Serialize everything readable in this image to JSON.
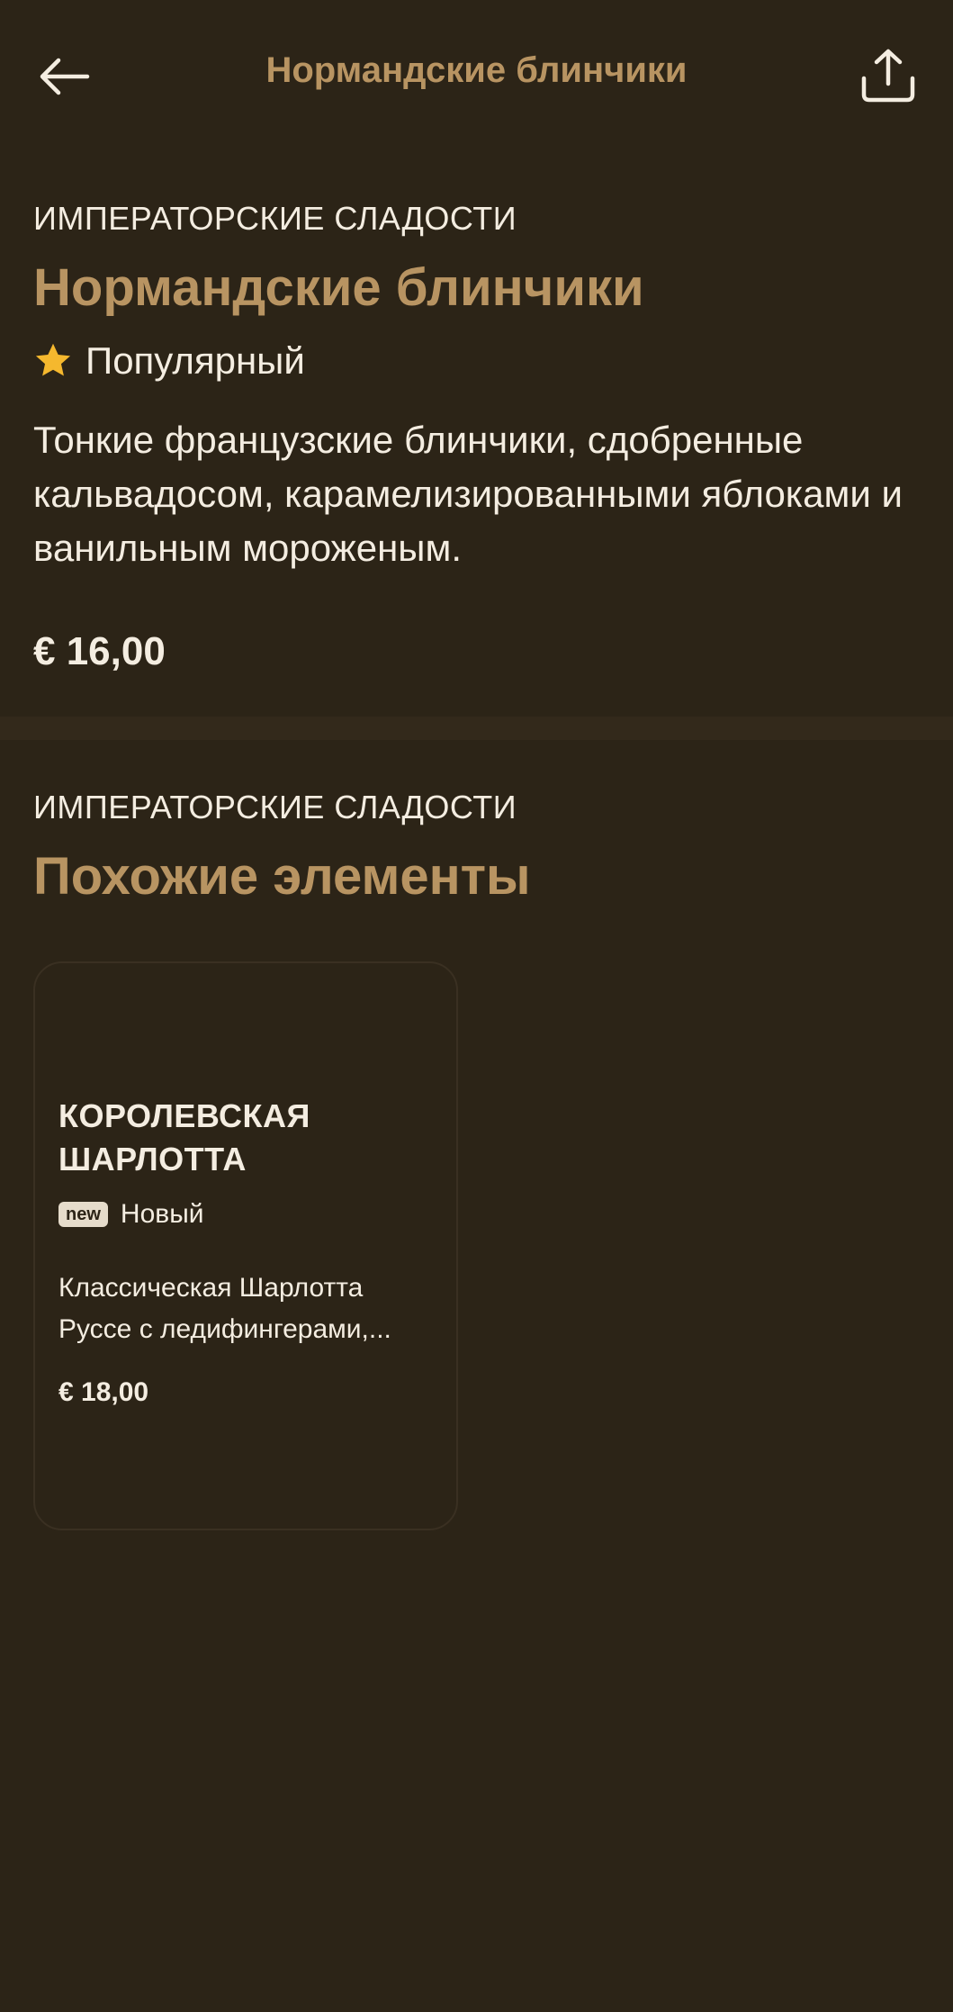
{
  "header": {
    "title": "Нормандские блинчики",
    "back_icon": "arrow-left-icon",
    "share_icon": "share-icon"
  },
  "dish": {
    "category": "ИМПЕРАТОРСКИЕ СЛАДОСТИ",
    "title": "Нормандские блинчики",
    "badge_icon": "star-icon",
    "badge_label": "Популярный",
    "description": "Тонкие французские блинчики, сдобренные кальвадосом, карамелизированными яблоками и ванильным мороженым.",
    "price": "€ 16,00"
  },
  "similar": {
    "category": "ИМПЕРАТОРСКИЕ СЛАДОСТИ",
    "title": "Похожие элементы",
    "items": [
      {
        "title": "КОРОЛЕВСКАЯ ШАРЛОТТА",
        "badge_pill": "new",
        "badge_label": "Новый",
        "description": "Классическая Шарлотта Руссе с ледифингерами,...",
        "price": "€ 18,00"
      }
    ]
  },
  "colors": {
    "background": "#2c2417",
    "accent": "#b89462",
    "text": "#f4ede1",
    "star": "#f5b82e"
  }
}
